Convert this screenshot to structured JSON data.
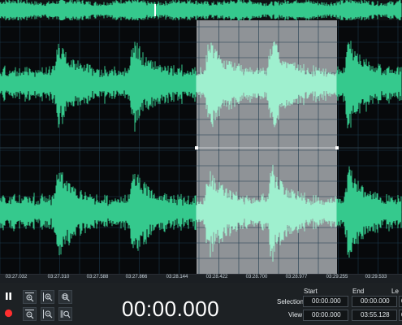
{
  "colors": {
    "wave": "#35c98d",
    "wave_selected": "#9ff0cf",
    "selection_bg": "#8f9397",
    "grid": "#1d3a4e",
    "record": "#ff2f2f"
  },
  "ruler": {
    "ticks": [
      "03:27.032",
      "03:27.310",
      "03:27.588",
      "03:27.866",
      "03:28.144",
      "03:28.422",
      "03:28.700",
      "03:28.977",
      "03:29.255",
      "03:29.533"
    ]
  },
  "controls": {
    "pause_icon": "pause-icon",
    "record_icon": "record-icon",
    "time": "00:00.000",
    "headers": {
      "start": "Start",
      "end": "End",
      "length": "Le"
    },
    "rows": [
      {
        "label": "Selection",
        "start": "00:00.000",
        "end": "00:00.000",
        "length": "00"
      },
      {
        "label": "View",
        "start": "00:00.000",
        "end": "03:55.128",
        "length": "03"
      }
    ]
  }
}
